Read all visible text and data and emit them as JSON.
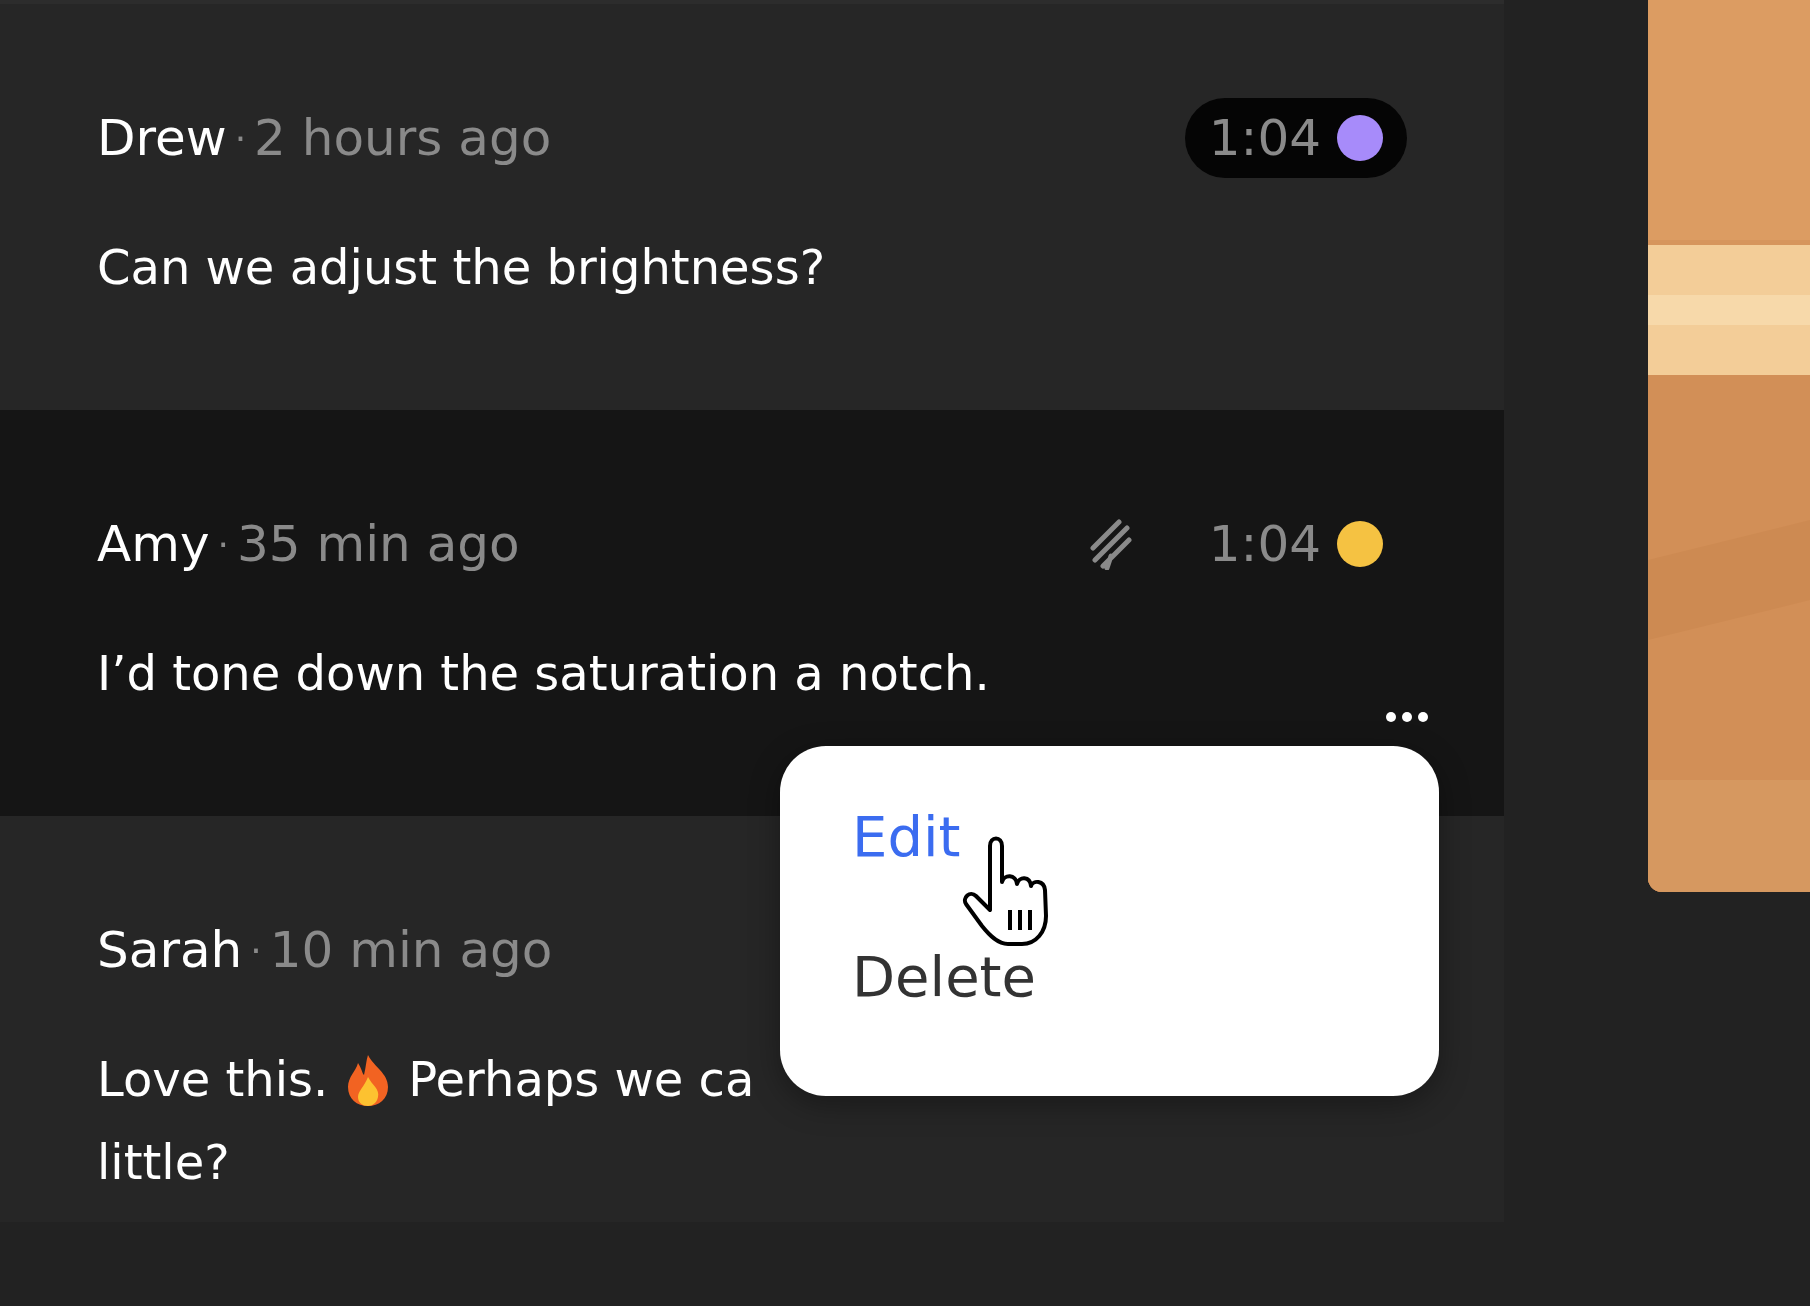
{
  "comments": [
    {
      "author": "Drew",
      "separator": "·",
      "age": "2 hours ago",
      "selected": false,
      "drawing": false,
      "more": false,
      "timestamp": {
        "text": "1:04",
        "pill": true,
        "color": "#a78bfa"
      },
      "body": [
        {
          "kind": "text",
          "text": "Can we adjust the brightness?"
        }
      ]
    },
    {
      "author": "Amy",
      "separator": "·",
      "age": "35 min ago",
      "selected": true,
      "drawing": true,
      "more": true,
      "timestamp": {
        "text": "1:04",
        "pill": false,
        "color": "#f5c242"
      },
      "body": [
        {
          "kind": "text",
          "text": "I’d tone down the saturation a notch."
        }
      ]
    },
    {
      "author": "Sarah",
      "separator": "·",
      "age": "10 min ago",
      "selected": false,
      "drawing": false,
      "more": false,
      "body": [
        {
          "kind": "line",
          "parts": [
            {
              "kind": "text",
              "text": "Love this."
            },
            {
              "kind": "fire"
            },
            {
              "kind": "text",
              "text": "Perhaps we ca"
            }
          ]
        },
        {
          "kind": "text",
          "text": "little?"
        }
      ]
    }
  ],
  "menu": {
    "items": [
      {
        "label": "Edit",
        "selected": true
      },
      {
        "label": "Delete",
        "selected": false
      }
    ]
  }
}
